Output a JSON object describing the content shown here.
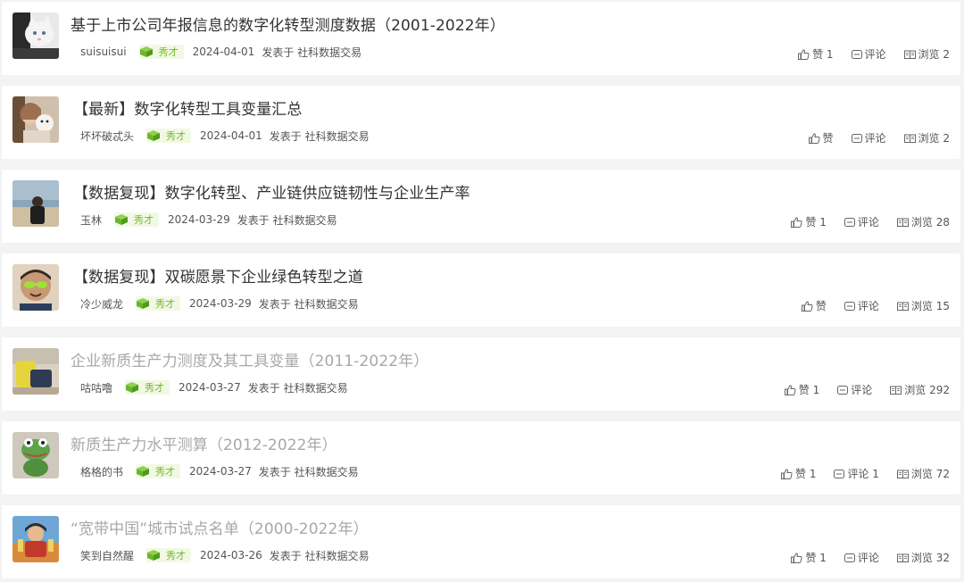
{
  "colors": {
    "page_bg": "#f2f3f5",
    "card_bg": "#ffffff",
    "title": "#333333",
    "title_dim": "#a8a8a8",
    "meta": "#555555",
    "badge_bg": "#f1f9e4",
    "badge_fg": "#72b82a"
  },
  "icons": {
    "badge": "green-cube-icon",
    "like": "thumbs-up-icon",
    "comment": "comment-icon",
    "view": "book-icon"
  },
  "posts": [
    {
      "title": "基于上市公司年报信息的数字化转型测度数据（2001-2022年）",
      "author": "suisuisui",
      "badge": "秀才",
      "date": "2024-04-01",
      "source": "发表于 社科数据交易",
      "like_label": "赞 1",
      "comment_label": "评论",
      "view_label": "浏览 2"
    },
    {
      "title": "【最新】数字化转型工具变量汇总",
      "author": "坏坏破忒头",
      "badge": "秀才",
      "date": "2024-04-01",
      "source": "发表于 社科数据交易",
      "like_label": "赞",
      "comment_label": "评论",
      "view_label": "浏览 2"
    },
    {
      "title": "【数据复现】数字化转型、产业链供应链韧性与企业生产率",
      "author": "玉林",
      "badge": "秀才",
      "date": "2024-03-29",
      "source": "发表于 社科数据交易",
      "like_label": "赞 1",
      "comment_label": "评论",
      "view_label": "浏览 28"
    },
    {
      "title": "【数据复现】双碳愿景下企业绿色转型之道",
      "author": "冷少威龙",
      "badge": "秀才",
      "date": "2024-03-29",
      "source": "发表于 社科数据交易",
      "like_label": "赞",
      "comment_label": "评论",
      "view_label": "浏览 15"
    },
    {
      "title": "企业新质生产力测度及其工具变量（2011-2022年）",
      "author": "咕咕噜",
      "badge": "秀才",
      "date": "2024-03-27",
      "source": "发表于 社科数据交易",
      "like_label": "赞 1",
      "comment_label": "评论",
      "view_label": "浏览 292"
    },
    {
      "title": "新质生产力水平测算（2012-2022年）",
      "author": "格格的书",
      "badge": "秀才",
      "date": "2024-03-27",
      "source": "发表于 社科数据交易",
      "like_label": "赞 1",
      "comment_label": "评论 1",
      "view_label": "浏览 72"
    },
    {
      "title": "“宽带中国”城市试点名单（2000-2022年）",
      "author": "笑到自然醒",
      "badge": "秀才",
      "date": "2024-03-26",
      "source": "发表于 社科数据交易",
      "like_label": "赞 1",
      "comment_label": "评论",
      "view_label": "浏览 32"
    }
  ]
}
